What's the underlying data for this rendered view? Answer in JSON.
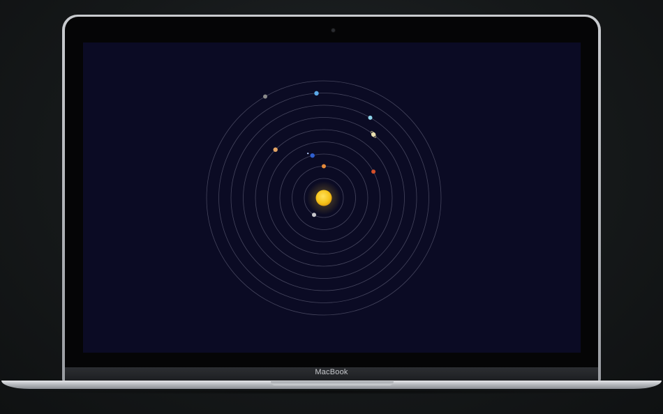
{
  "device": {
    "brand_label": "MacBook"
  },
  "app": {
    "background_color": "#0b0b24",
    "orbit_color": "#5a5a72",
    "sun": {
      "name": "sun",
      "color": "#f5c31a"
    },
    "planets": [
      {
        "name": "mercury",
        "orbit": 1,
        "angle_deg": 210,
        "color": "#c8c8cc"
      },
      {
        "name": "venus",
        "orbit": 2,
        "angle_deg": 0,
        "color": "#e58a3a"
      },
      {
        "name": "earth",
        "orbit": 3,
        "angle_deg": 345,
        "color": "#2f5fd0"
      },
      {
        "name": "mars",
        "orbit": 4,
        "angle_deg": 62,
        "color": "#d5502a"
      },
      {
        "name": "jupiter",
        "orbit": 5,
        "angle_deg": 315,
        "color": "#e3a464"
      },
      {
        "name": "saturn",
        "orbit": 6,
        "angle_deg": 38,
        "color": "#eadfb0"
      },
      {
        "name": "uranus",
        "orbit": 7,
        "angle_deg": 30,
        "color": "#8dd3ea"
      },
      {
        "name": "neptune",
        "orbit": 8,
        "angle_deg": 356,
        "color": "#5aa8e8"
      },
      {
        "name": "pluto",
        "orbit": 9,
        "angle_deg": 330,
        "color": "#8a8a8a"
      }
    ],
    "moon": {
      "name": "moon",
      "color": "#bcd4ff"
    }
  }
}
